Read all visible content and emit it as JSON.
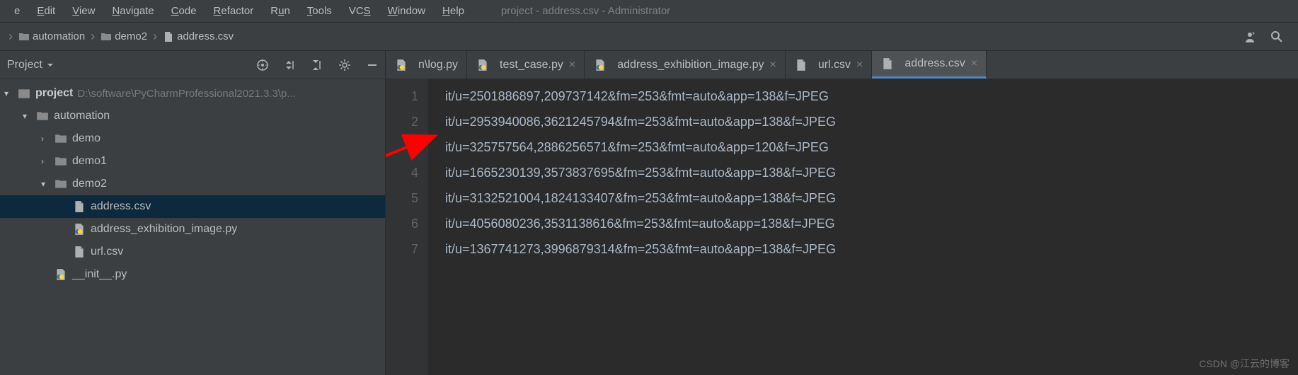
{
  "window_title": "project - address.csv - Administrator",
  "menu": [
    "File",
    "Edit",
    "View",
    "Navigate",
    "Code",
    "Refactor",
    "Run",
    "Tools",
    "VCS",
    "Window",
    "Help"
  ],
  "menu_mnemonics": [
    "e",
    "E",
    "V",
    "N",
    "C",
    "R",
    "u",
    "T",
    "S",
    "W",
    "H"
  ],
  "menu_display": [
    {
      "pre": "",
      "u": "",
      "post": "e"
    },
    {
      "pre": "",
      "u": "E",
      "post": "dit"
    },
    {
      "pre": "",
      "u": "V",
      "post": "iew"
    },
    {
      "pre": "",
      "u": "N",
      "post": "avigate"
    },
    {
      "pre": "",
      "u": "C",
      "post": "ode"
    },
    {
      "pre": "",
      "u": "R",
      "post": "efactor"
    },
    {
      "pre": "R",
      "u": "u",
      "post": "n"
    },
    {
      "pre": "",
      "u": "T",
      "post": "ools"
    },
    {
      "pre": "VC",
      "u": "S",
      "post": ""
    },
    {
      "pre": "",
      "u": "W",
      "post": "indow"
    },
    {
      "pre": "",
      "u": "H",
      "post": "elp"
    }
  ],
  "breadcrumbs": [
    "automation",
    "demo2",
    "address.csv"
  ],
  "project_panel": {
    "title": "Project",
    "root_name": "project",
    "root_path": "D:\\software\\PyCharmProfessional2021.3.3\\p...",
    "tree": [
      {
        "name": "automation",
        "type": "folder",
        "depth": 1,
        "expanded": true
      },
      {
        "name": "demo",
        "type": "folder",
        "depth": 2,
        "expanded": false
      },
      {
        "name": "demo1",
        "type": "folder",
        "depth": 2,
        "expanded": false
      },
      {
        "name": "demo2",
        "type": "folder",
        "depth": 2,
        "expanded": true
      },
      {
        "name": "address.csv",
        "type": "csv",
        "depth": 3,
        "selected": true
      },
      {
        "name": "address_exhibition_image.py",
        "type": "py",
        "depth": 3
      },
      {
        "name": "url.csv",
        "type": "csv",
        "depth": 3
      },
      {
        "name": "__init__.py",
        "type": "py",
        "depth": 2
      }
    ]
  },
  "tabs": [
    {
      "label": "n\\log.py",
      "type": "py",
      "partial": true
    },
    {
      "label": "test_case.py",
      "type": "py"
    },
    {
      "label": "address_exhibition_image.py",
      "type": "py"
    },
    {
      "label": "url.csv",
      "type": "csv"
    },
    {
      "label": "address.csv",
      "type": "csv",
      "active": true
    }
  ],
  "editor": {
    "lines": [
      "it/u=2501886897,209737142&fm=253&fmt=auto&app=138&f=JPEG",
      "it/u=2953940086,3621245794&fm=253&fmt=auto&app=138&f=JPEG",
      "it/u=325757564,2886256571&fm=253&fmt=auto&app=120&f=JPEG",
      "it/u=1665230139,3573837695&fm=253&fmt=auto&app=138&f=JPEG",
      "it/u=3132521004,1824133407&fm=253&fmt=auto&app=138&f=JPEG",
      "it/u=4056080236,3531138616&fm=253&fmt=auto&app=138&f=JPEG",
      "it/u=1367741273,3996879314&fm=253&fmt=auto&app=138&f=JPEG"
    ]
  },
  "watermark": "CSDN @江云的博客"
}
